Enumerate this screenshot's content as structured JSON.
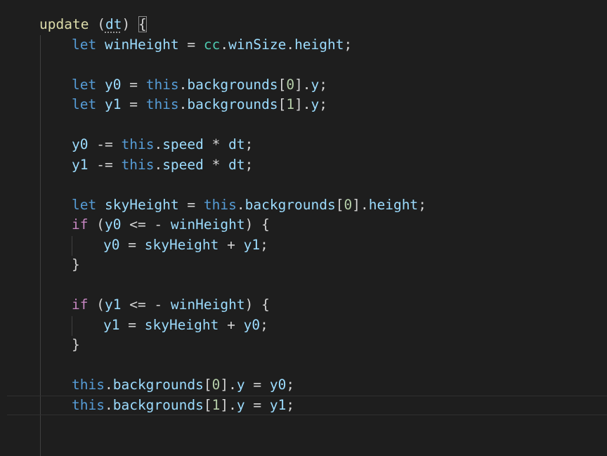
{
  "editor": {
    "theme_colors": {
      "background": "#1e1e1e",
      "keyword": "#569cd6",
      "control": "#c586c0",
      "variable": "#9cdcfe",
      "function": "#dcdcaa",
      "number": "#b5cea8",
      "namespace": "#4ec9b0",
      "text": "#d4d4d4"
    },
    "lines": [
      {
        "fn": "update",
        "param": "dt"
      },
      {
        "kw": "let",
        "var": "winHeight",
        "ns": "cc",
        "prop1": "winSize",
        "prop2": "height"
      },
      {
        "kw": "let",
        "var": "y0",
        "this": "this",
        "prop": "backgrounds",
        "idx": "0",
        "field": "y"
      },
      {
        "kw": "let",
        "var": "y1",
        "this": "this",
        "prop": "backgrounds",
        "idx": "1",
        "field": "y"
      },
      {
        "var": "y0",
        "op": "-=",
        "this": "this",
        "prop": "speed",
        "op2": "*",
        "var2": "dt"
      },
      {
        "var": "y1",
        "op": "-=",
        "this": "this",
        "prop": "speed",
        "op2": "*",
        "var2": "dt"
      },
      {
        "kw": "let",
        "var": "skyHeight",
        "this": "this",
        "prop": "backgrounds",
        "idx": "0",
        "field": "height"
      },
      {
        "ctl": "if",
        "var": "y0",
        "op": "<=",
        "var2": "winHeight"
      },
      {
        "var": "y0",
        "var2": "skyHeight",
        "var3": "y1"
      },
      {
        "ctl": "if",
        "var": "y1",
        "op": "<=",
        "var2": "winHeight"
      },
      {
        "var": "y1",
        "var2": "skyHeight",
        "var3": "y0"
      },
      {
        "this": "this",
        "prop": "backgrounds",
        "idx": "0",
        "field": "y",
        "var": "y0"
      },
      {
        "this": "this",
        "prop": "backgrounds",
        "idx": "1",
        "field": "y",
        "var": "y1"
      }
    ]
  }
}
